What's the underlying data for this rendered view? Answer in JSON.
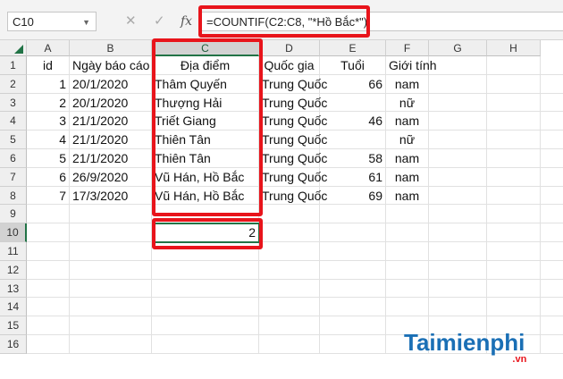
{
  "name_box": "C10",
  "formula": "=COUNTIF(C2:C8, \"*Hồ Bắc*\")",
  "icons": {
    "cancel": "✕",
    "confirm": "✓",
    "fx": "fx"
  },
  "columns": [
    "A",
    "B",
    "C",
    "D",
    "E",
    "F",
    "G",
    "H"
  ],
  "rows": [
    "1",
    "2",
    "3",
    "4",
    "5",
    "6",
    "7",
    "8",
    "9",
    "10",
    "11",
    "12",
    "13",
    "14",
    "15",
    "16"
  ],
  "headers": [
    "id",
    "Ngày báo cáo",
    "Địa điểm",
    "Quốc gia",
    "Tuổi",
    "Giới tính"
  ],
  "data": [
    [
      "1",
      "20/1/2020",
      "Thâm Quyến",
      "Trung Quốc",
      "66",
      "nam"
    ],
    [
      "2",
      "20/1/2020",
      "Thượng Hải",
      "Trung Quốc",
      "",
      "nữ"
    ],
    [
      "3",
      "21/1/2020",
      "Triết Giang",
      "Trung Quốc",
      "46",
      "nam"
    ],
    [
      "4",
      "21/1/2020",
      "Thiên Tân",
      "Trung Quốc",
      "",
      "nữ"
    ],
    [
      "5",
      "21/1/2020",
      "Thiên Tân",
      "Trung Quốc",
      "58",
      "nam"
    ],
    [
      "6",
      "26/9/2020",
      "Vũ Hán, Hồ Bắc",
      "Trung Quốc",
      "61",
      "nam"
    ],
    [
      "7",
      "17/3/2020",
      "Vũ Hán, Hồ Bắc",
      "Trung Quốc",
      "69",
      "nam"
    ]
  ],
  "result": "2",
  "watermark": {
    "brand": "Taimienphi",
    "suffix": ".vn"
  },
  "colors": {
    "highlight": "#e8141b",
    "excel_green": "#217346"
  }
}
